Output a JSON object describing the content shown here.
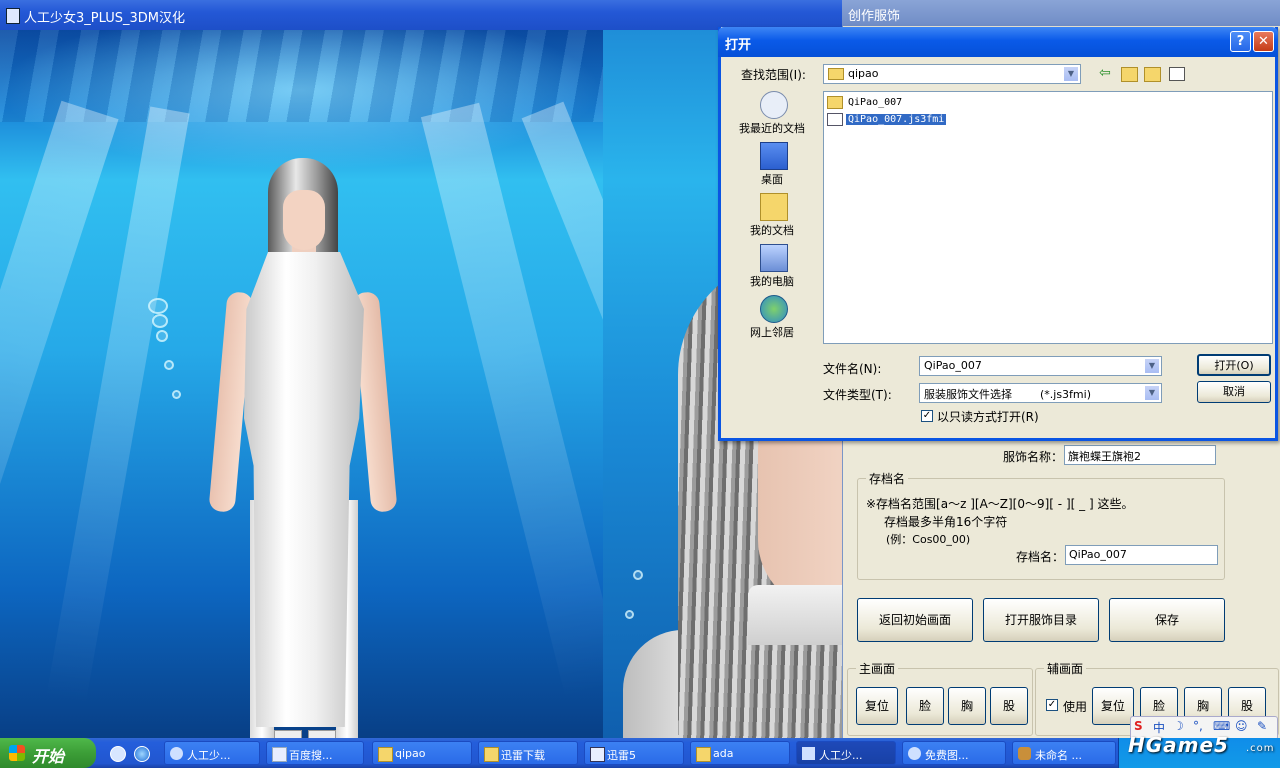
{
  "game_window": {
    "title": "人工少女3_PLUS_3DM汉化"
  },
  "panel": {
    "title": "创作服饰",
    "costume_name_label": "服饰名称：",
    "costume_name_value": "旗袍蝶王旗袍2",
    "save_group_label": "存档名",
    "save_note_1": "※存档名范围[a～z ][A～Z][0～9][ - ][ _ ] 这些。",
    "save_note_2": "存档最多半角16个字符",
    "save_note_3": "(例：Cos00_00)",
    "save_name_label": "存档名：",
    "save_name_value": "QiPao_007",
    "buttons": {
      "back": "返回初始画面",
      "open_dir": "打开服饰目录",
      "save": "保存"
    },
    "main_view": {
      "label": "主画面",
      "reset": "复位",
      "face": "脸",
      "chest": "胸",
      "crotch": "股"
    },
    "sub_view": {
      "label": "辅画面",
      "use": "使用",
      "reset": "复位",
      "face": "脸",
      "chest": "胸",
      "crotch": "股"
    }
  },
  "open_dialog": {
    "title": "打开",
    "look_in_label": "查找范围(I):",
    "look_in_value": "qipao",
    "places": [
      {
        "label": "我最近的文档",
        "icon": "recent-docs-icon"
      },
      {
        "label": "桌面",
        "icon": "desktop-icon"
      },
      {
        "label": "我的文档",
        "icon": "my-documents-icon"
      },
      {
        "label": "我的电脑",
        "icon": "my-computer-icon"
      },
      {
        "label": "网上邻居",
        "icon": "network-icon"
      }
    ],
    "files": [
      {
        "name": "QiPao_007",
        "kind": "folder"
      },
      {
        "name": "QiPao_007.js3fmi",
        "kind": "file"
      }
    ],
    "filename_label": "文件名(N):",
    "filename_value": "QiPao_007",
    "filetype_label": "文件类型(T):",
    "filetype_value": "服装服饰文件选择        (*.js3fmi)",
    "readonly_label": "以只读方式打开(R)",
    "open_button": "打开(O)",
    "cancel_button": "取消"
  },
  "taskbar": {
    "start_label": "开始",
    "tasks": [
      {
        "label": "人工少..."
      },
      {
        "label": "百度搜..."
      },
      {
        "label": "qipao"
      },
      {
        "label": "迅雷下载"
      },
      {
        "label": "迅雷5"
      },
      {
        "label": "ada"
      },
      {
        "label": "人工少..."
      },
      {
        "label": "免费图..."
      },
      {
        "label": "未命名 ..."
      }
    ]
  },
  "ime_bar": {
    "items": [
      "S",
      "中",
      "☽",
      "°,",
      "⌨",
      "☺",
      "✎"
    ]
  },
  "watermark": {
    "text": "HGame5",
    "sub": ".com"
  }
}
